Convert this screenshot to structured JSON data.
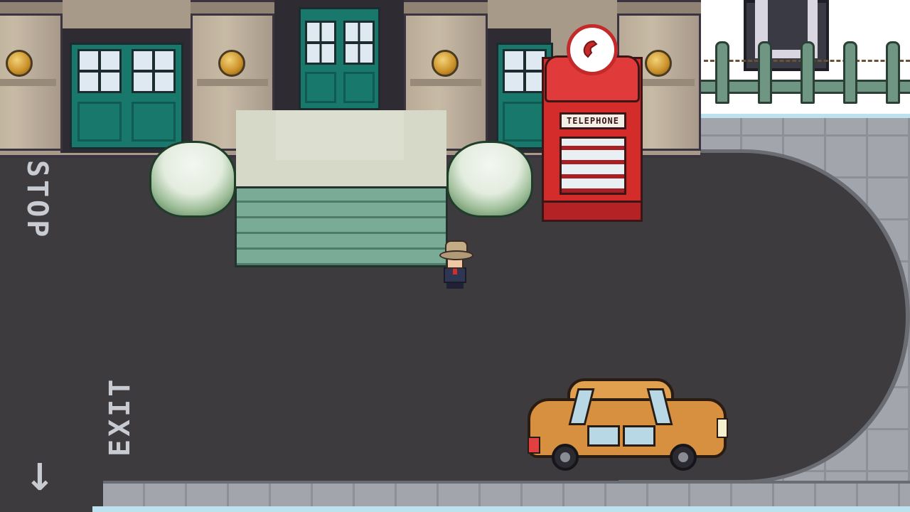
{
  "scene": {
    "type": "pixel-art town street",
    "road_markings": {
      "stop": "STOP",
      "exit": "EXIT",
      "arrow": "↓"
    },
    "phone_booth_sign": "TELEPHONE",
    "character": "player",
    "vehicle": "taxi car"
  },
  "colors": {
    "road": "#3d3b3e",
    "building": "#a89a88",
    "door": "#17786b",
    "booth": "#d42b2b",
    "car": "#d7903f",
    "sidewalk": "#a3a5ac",
    "snow": "#ffffff"
  },
  "icons": {
    "phone_badge": "phone-icon",
    "arrow": "down-arrow-icon"
  }
}
